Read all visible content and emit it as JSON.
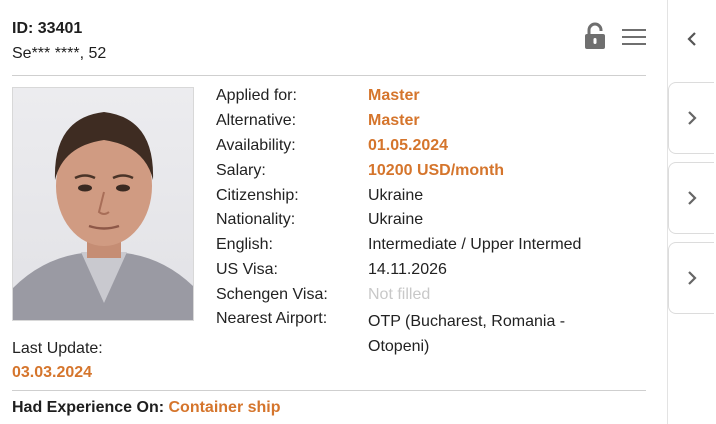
{
  "candidate": {
    "id_label": "ID: 33401",
    "name_age": "Se*** ****, 52",
    "last_update_label": "Last Update:",
    "last_update_value": "03.03.2024"
  },
  "details": {
    "rows": [
      {
        "label": "Applied for:",
        "value": "Master",
        "style": "accent"
      },
      {
        "label": "Alternative:",
        "value": "Master",
        "style": "accent"
      },
      {
        "label": "Availability:",
        "value": "01.05.2024",
        "style": "accent"
      },
      {
        "label": "Salary:",
        "value": "10200 USD/month",
        "style": "accent"
      },
      {
        "label": "Citizenship:",
        "value": "Ukraine",
        "style": "normal"
      },
      {
        "label": "Nationality:",
        "value": "Ukraine",
        "style": "normal"
      },
      {
        "label": "English:",
        "value": "Intermediate / Upper Intermed",
        "style": "normal"
      },
      {
        "label": "US Visa:",
        "value": "14.11.2026",
        "style": "normal"
      },
      {
        "label": "Schengen Visa:",
        "value": "Not filled",
        "style": "muted"
      },
      {
        "label": "Nearest Airport:",
        "value": "OTP (Bucharest, Romania - Otopeni)",
        "style": "normal"
      }
    ]
  },
  "experience": {
    "label": "Had Experience On:",
    "value": "Container ship"
  },
  "icons": {
    "lock": "lock-open-icon",
    "menu": "hamburger-menu-icon",
    "collapse": "chevron-left-icon",
    "expand": "chevron-right-icon"
  },
  "colors": {
    "accent": "#d5752c",
    "muted": "#c8c8c8",
    "icon": "#777777"
  }
}
